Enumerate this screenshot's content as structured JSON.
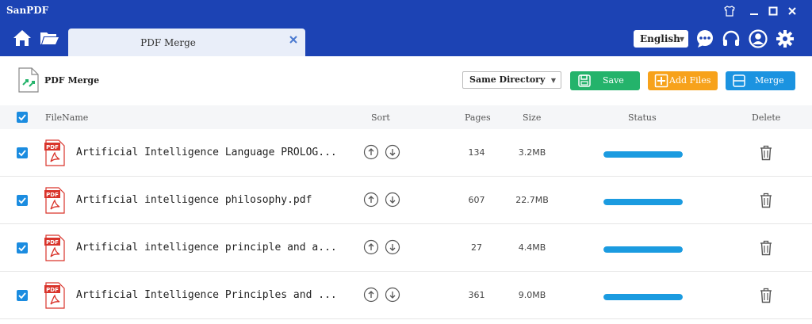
{
  "app": {
    "title": "SanPDF"
  },
  "window_controls": [
    "shirt-icon",
    "minimize-icon",
    "maximize-icon",
    "close-icon"
  ],
  "nav": {
    "tab_label": "PDF Merge",
    "language": "English",
    "icons": [
      "home-icon",
      "folder-icon",
      "chat-icon",
      "headset-icon",
      "user-icon",
      "gear-icon"
    ]
  },
  "toolbar": {
    "title": "PDF Merge",
    "directory": "Same Directory",
    "save_label": "Save",
    "add_files_label": "Add Files",
    "merge_label": "Merge"
  },
  "table": {
    "headers": {
      "filename": "FileName",
      "sort": "Sort",
      "pages": "Pages",
      "size": "Size",
      "status": "Status",
      "delete": "Delete"
    },
    "rows": [
      {
        "name": "Artificial Intelligence Language PROLOG...",
        "pages": "134",
        "size": "3.2MB",
        "progress": 1.0,
        "checked": true
      },
      {
        "name": "Artificial intelligence philosophy.pdf",
        "pages": "607",
        "size": "22.7MB",
        "progress": 1.0,
        "checked": true
      },
      {
        "name": "Artificial intelligence principle and a...",
        "pages": "27",
        "size": "4.4MB",
        "progress": 1.0,
        "checked": true
      },
      {
        "name": "Artificial Intelligence Principles and ...",
        "pages": "361",
        "size": "9.0MB",
        "progress": 1.0,
        "checked": true
      }
    ]
  },
  "colors": {
    "titlebar": "#1c43b4",
    "accent": "#1b8ce0",
    "save": "#24b36b",
    "add_files": "#f7a21b",
    "merge": "#1b93e0",
    "pdf_red": "#d9342b"
  }
}
